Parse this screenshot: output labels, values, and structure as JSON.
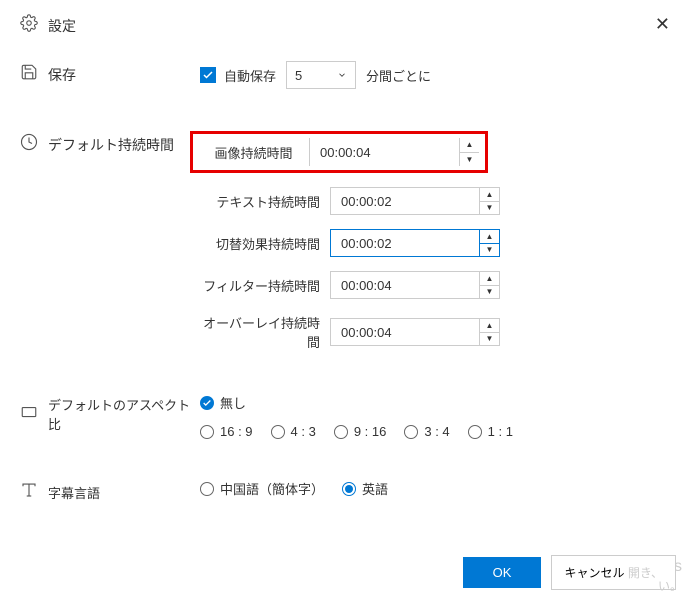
{
  "header": {
    "title": "設定"
  },
  "save": {
    "section_label": "保存",
    "autosave_label": "自動保存",
    "interval_value": "5",
    "interval_suffix": "分間ごとに"
  },
  "duration": {
    "section_label": "デフォルト持続時間",
    "image": {
      "label": "画像持続時間",
      "value": "00:00:04"
    },
    "text": {
      "label": "テキスト持続時間",
      "value": "00:00:02"
    },
    "transition": {
      "label": "切替効果持続時間",
      "value": "00:00:02"
    },
    "filter": {
      "label": "フィルター持続時間",
      "value": "00:00:04"
    },
    "overlay": {
      "label": "オーバーレイ持続時間",
      "value": "00:00:04"
    }
  },
  "aspect": {
    "section_label": "デフォルトのアスペクト比",
    "options": {
      "none": "無し",
      "r169": "16 : 9",
      "r43": "4 : 3",
      "r916": "9 : 16",
      "r34": "3 : 4",
      "r11": "1 : 1"
    }
  },
  "subtitle": {
    "section_label": "字幕言語",
    "chinese": "中国語（簡体字）",
    "english": "英語"
  },
  "footer": {
    "ok": "OK",
    "cancel": "キャンセル"
  },
  "watermark": {
    "line1": "Windows",
    "line2": "開き、",
    "line3": "い。"
  }
}
